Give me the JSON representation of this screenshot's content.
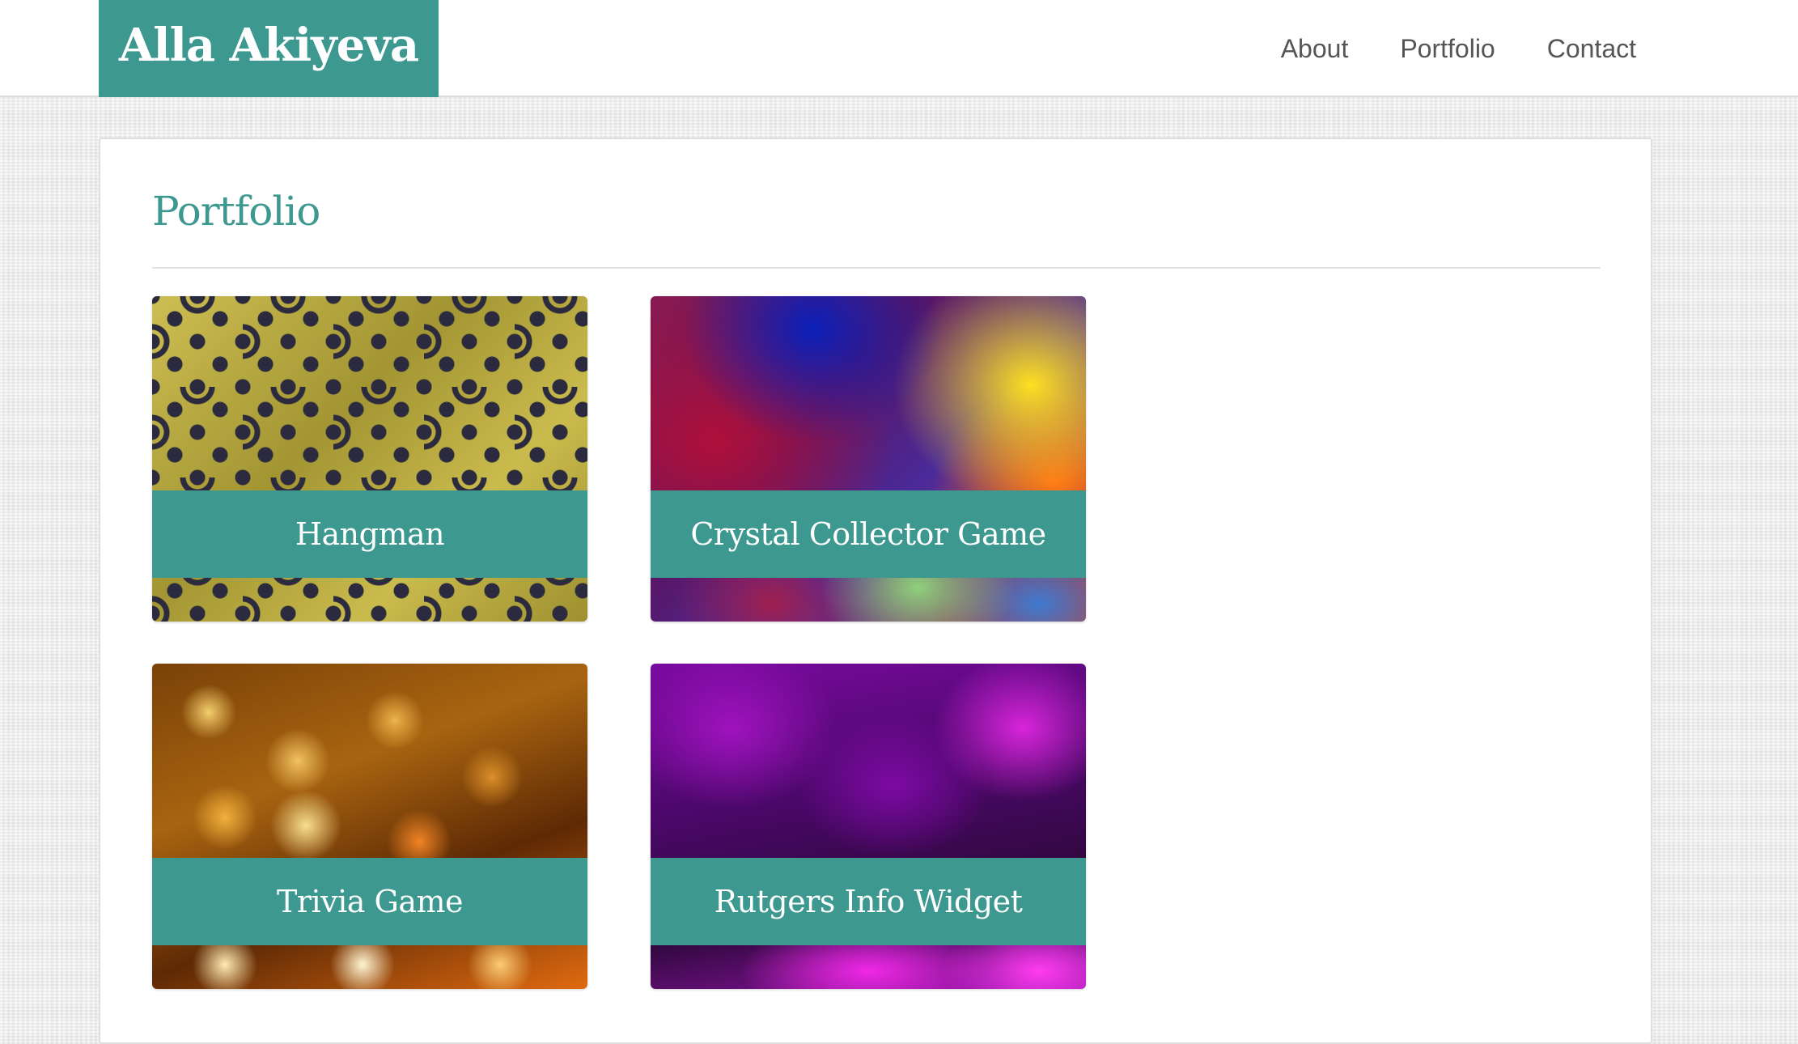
{
  "header": {
    "brand": "Alla Akiyeva",
    "nav": [
      {
        "label": "About"
      },
      {
        "label": "Portfolio"
      },
      {
        "label": "Contact"
      }
    ]
  },
  "main": {
    "title": "Portfolio",
    "projects": [
      {
        "title": "Hangman"
      },
      {
        "title": "Crystal Collector Game"
      },
      {
        "title": "Trivia Game"
      },
      {
        "title": "Rutgers Info Widget"
      }
    ]
  },
  "colors": {
    "accent": "#3d9990",
    "nav_text": "#555555",
    "page_background": "#ececec"
  }
}
